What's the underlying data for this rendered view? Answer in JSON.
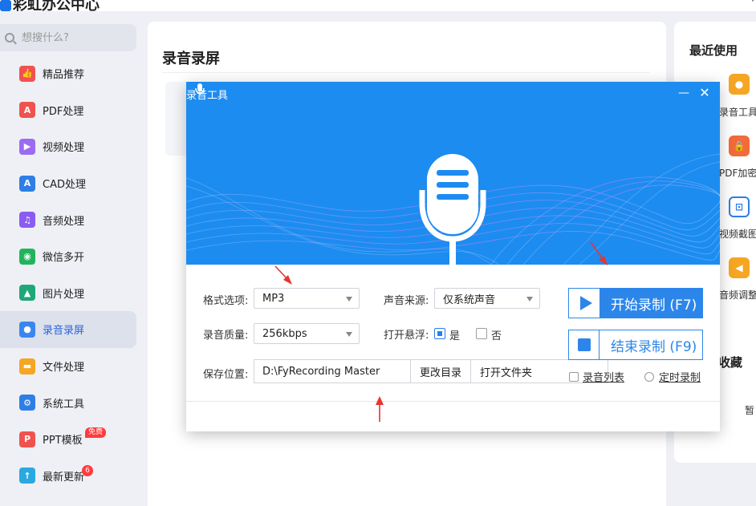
{
  "app": {
    "title": "彩虹办公中心"
  },
  "search": {
    "placeholder": "想搜什么?"
  },
  "sidebar": {
    "items": [
      {
        "label": "精品推荐",
        "icon": "thumbs-up-icon",
        "color": "#f0524f"
      },
      {
        "label": "PDF处理",
        "icon": "pdf-icon",
        "color": "#f0524f"
      },
      {
        "label": "视频处理",
        "icon": "video-icon",
        "color": "#9b6bf2"
      },
      {
        "label": "CAD处理",
        "icon": "cad-icon",
        "color": "#2f7ee6"
      },
      {
        "label": "音频处理",
        "icon": "music-icon",
        "color": "#8a5cf0"
      },
      {
        "label": "微信多开",
        "icon": "wechat-icon",
        "color": "#22b45c"
      },
      {
        "label": "图片处理",
        "icon": "image-icon",
        "color": "#1fa77a"
      },
      {
        "label": "录音录屏",
        "icon": "microphone-icon",
        "color": "#3a86f0"
      },
      {
        "label": "文件处理",
        "icon": "folder-icon",
        "color": "#f5a623"
      },
      {
        "label": "系统工具",
        "icon": "gear-icon",
        "color": "#2f7ee6"
      },
      {
        "label": "PPT模板",
        "icon": "ppt-icon",
        "color": "#f0524f",
        "badge": "免费"
      },
      {
        "label": "最新更新",
        "icon": "upload-icon",
        "color": "#2aa8e0",
        "count": "6"
      }
    ],
    "active_index": 7
  },
  "main": {
    "title": "录音录屏"
  },
  "recent": {
    "title": "最近使用",
    "items": [
      {
        "label": "录音工具",
        "icon": "microphone-icon",
        "color": "#f5a623"
      },
      {
        "label": "PDF加密",
        "icon": "lock-icon",
        "color": "#f26b3a"
      },
      {
        "label": "视频截图",
        "icon": "crop-icon",
        "color": "#2f7ee6"
      },
      {
        "label": "音频调整",
        "icon": "speaker-icon",
        "color": "#f5a623"
      }
    ],
    "fav_title": "收藏",
    "fav_empty": "暂"
  },
  "dialog": {
    "title": "录音工具",
    "format_label": "格式选项:",
    "format_value": "MP3",
    "source_label": "声音来源:",
    "source_value": "仅系统声音",
    "quality_label": "录音质量:",
    "quality_value": "256kbps",
    "float_label": "打开悬浮:",
    "float_yes": "是",
    "float_no": "否",
    "float_checked": "是",
    "save_label": "保存位置:",
    "save_path": "D:\\FyRecording Master",
    "change_dir": "更改目录",
    "open_folder": "打开文件夹",
    "start_btn": "开始录制 (F7)",
    "stop_btn": "结束录制 (F9)",
    "list_link": "录音列表",
    "timer_link": "定时录制",
    "hero_color": "#1d8cf0",
    "accent_color": "#2c86ea"
  }
}
